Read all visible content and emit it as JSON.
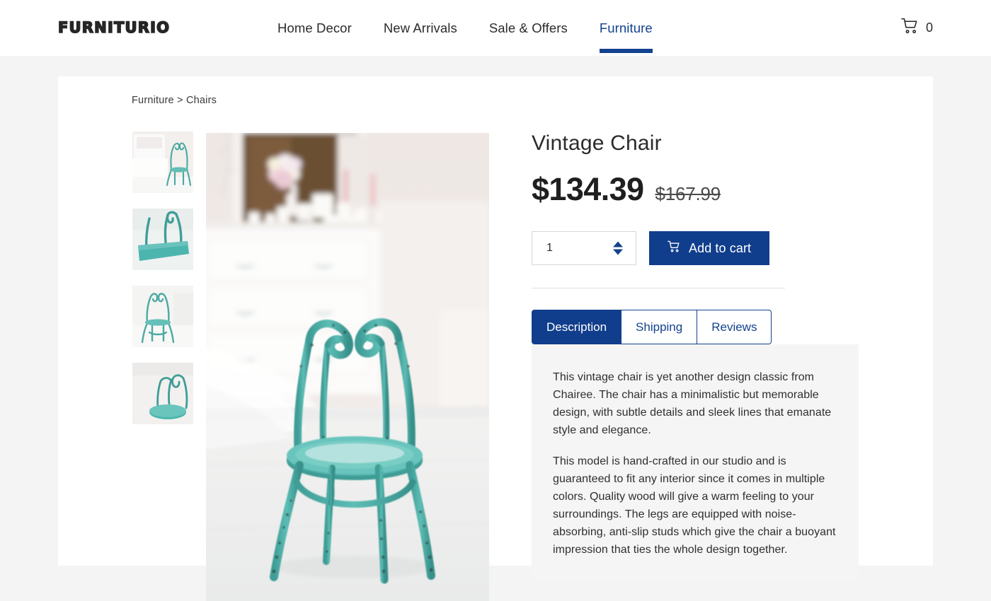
{
  "header": {
    "logo": "FURNITURIO",
    "nav": [
      {
        "label": "Home Decor",
        "active": false
      },
      {
        "label": "New Arrivals",
        "active": false
      },
      {
        "label": "Sale & Offers",
        "active": false
      },
      {
        "label": "Furniture",
        "active": true
      }
    ],
    "cart": {
      "icon": "shopping-cart-icon",
      "count": "0"
    }
  },
  "breadcrumb": "Furniture > Chairs",
  "gallery": {
    "thumbnails": [
      {
        "alt": "Vintage teal chair beside white dresser, full room view"
      },
      {
        "alt": "Close-up of teal chair backrest scroll detail"
      },
      {
        "alt": "Teal chair front view on white floor"
      },
      {
        "alt": "Teal chair angled view showing round seat"
      }
    ],
    "main": {
      "alt": "Teal vintage bentwood chair in front of white vintage dresser with candles and flowers"
    }
  },
  "product": {
    "title": "Vintage Chair",
    "price_current": "$134.39",
    "price_original": "$167.99",
    "quantity": "1",
    "add_to_cart_label": "Add to cart",
    "cart_icon": "shopping-cart-icon"
  },
  "tabs": [
    {
      "label": "Description",
      "active": true
    },
    {
      "label": "Shipping",
      "active": false
    },
    {
      "label": "Reviews",
      "active": false
    }
  ],
  "description": {
    "paragraph1": "This vintage chair is yet another design classic from Chairee. The chair has a minimalistic but memorable design, with subtle details and sleek lines that emanate style and elegance.",
    "paragraph2": "This model is hand-crafted in our studio and is guaranteed to fit any interior since it comes in multiple colors. Quality wood will give a warm feeling to your surroundings. The legs are equipped with noise-absorbing, anti-slip studs which give the chair a buoyant impression that ties the whole design together."
  },
  "colors": {
    "accent_blue": "#13428f",
    "button_blue": "#113e8c",
    "page_background": "#f4f4f4",
    "panel_background": "#f5f5f5",
    "chair_teal": "#53b3ab"
  }
}
